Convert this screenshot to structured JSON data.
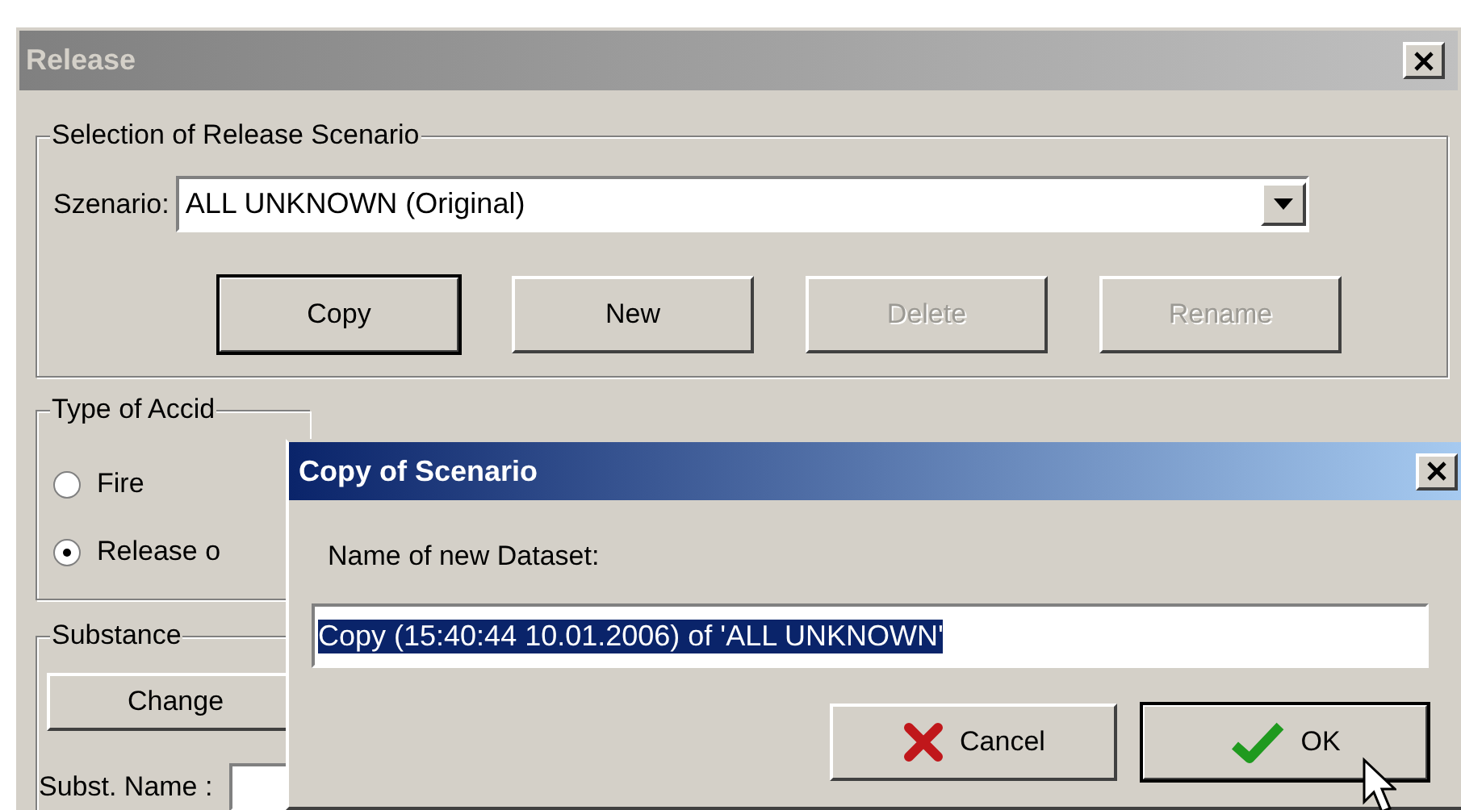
{
  "window": {
    "title": "Release"
  },
  "scenario_group": {
    "legend": "Selection of Release Scenario",
    "label": "Szenario:",
    "value": "ALL UNKNOWN (Original)",
    "buttons": [
      {
        "label": "Copy",
        "default": true,
        "disabled": false
      },
      {
        "label": "New",
        "default": false,
        "disabled": false
      },
      {
        "label": "Delete",
        "default": false,
        "disabled": true
      },
      {
        "label": "Rename",
        "default": false,
        "disabled": true
      }
    ]
  },
  "accident_group": {
    "legend": "Type of Accid",
    "options": [
      {
        "label": "Fire",
        "selected": false
      },
      {
        "label": "Release o",
        "selected": true
      }
    ]
  },
  "substance_group": {
    "legend": "Substance",
    "button": "Change",
    "name_label": "Subst. Name :"
  },
  "dialog": {
    "title": "Copy of Scenario",
    "prompt": "Name of new Dataset:",
    "value": "Copy (15:40:44 10.01.2006) of 'ALL UNKNOWN'",
    "value_selected": true,
    "buttons": [
      {
        "label": "Cancel",
        "kind": "cancel",
        "default": false
      },
      {
        "label": "OK",
        "kind": "ok",
        "default": true
      }
    ]
  }
}
